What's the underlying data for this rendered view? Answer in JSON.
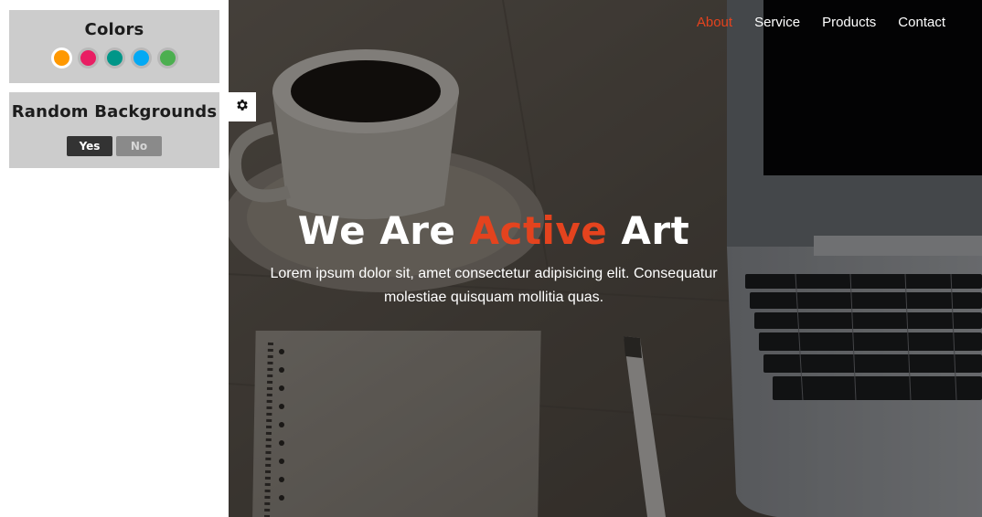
{
  "settings": {
    "colors_title": "Colors",
    "colors": [
      {
        "name": "orange",
        "hex": "#ff9800",
        "active": true
      },
      {
        "name": "pink",
        "hex": "#e91e63",
        "active": false
      },
      {
        "name": "teal",
        "hex": "#009688",
        "active": false
      },
      {
        "name": "light-blue",
        "hex": "#03a9f4",
        "active": false
      },
      {
        "name": "green",
        "hex": "#4caf50",
        "active": false
      }
    ],
    "random_title": "Random Backgrounds",
    "yes_label": "Yes",
    "no_label": "No",
    "gear_icon": "gear-icon"
  },
  "nav": {
    "items": [
      {
        "label": "About",
        "active": true
      },
      {
        "label": "Service",
        "active": false
      },
      {
        "label": "Products",
        "active": false
      },
      {
        "label": "Contact",
        "active": false
      }
    ],
    "active_color": "#e4431e"
  },
  "hero": {
    "title_prefix": "We Are ",
    "title_accent": "Active",
    "title_suffix": " Art",
    "description": "Lorem ipsum dolor sit, amet consectetur adipisicing elit. Consequatur molestiae quisquam mollitia quas.",
    "accent_color": "#e4431e"
  }
}
